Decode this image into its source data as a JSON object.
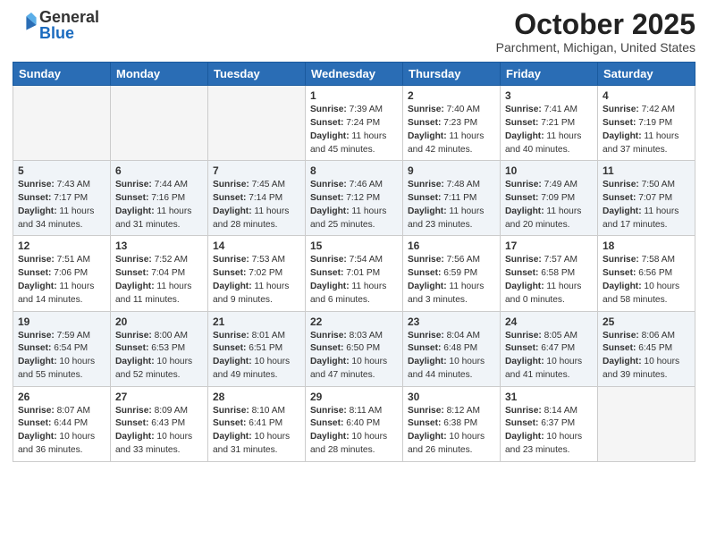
{
  "header": {
    "logo_general": "General",
    "logo_blue": "Blue",
    "month_title": "October 2025",
    "location": "Parchment, Michigan, United States"
  },
  "days_of_week": [
    "Sunday",
    "Monday",
    "Tuesday",
    "Wednesday",
    "Thursday",
    "Friday",
    "Saturday"
  ],
  "weeks": [
    [
      {
        "day": "",
        "info": ""
      },
      {
        "day": "",
        "info": ""
      },
      {
        "day": "",
        "info": ""
      },
      {
        "day": "1",
        "info": "Sunrise: 7:39 AM\nSunset: 7:24 PM\nDaylight: 11 hours\nand 45 minutes."
      },
      {
        "day": "2",
        "info": "Sunrise: 7:40 AM\nSunset: 7:23 PM\nDaylight: 11 hours\nand 42 minutes."
      },
      {
        "day": "3",
        "info": "Sunrise: 7:41 AM\nSunset: 7:21 PM\nDaylight: 11 hours\nand 40 minutes."
      },
      {
        "day": "4",
        "info": "Sunrise: 7:42 AM\nSunset: 7:19 PM\nDaylight: 11 hours\nand 37 minutes."
      }
    ],
    [
      {
        "day": "5",
        "info": "Sunrise: 7:43 AM\nSunset: 7:17 PM\nDaylight: 11 hours\nand 34 minutes."
      },
      {
        "day": "6",
        "info": "Sunrise: 7:44 AM\nSunset: 7:16 PM\nDaylight: 11 hours\nand 31 minutes."
      },
      {
        "day": "7",
        "info": "Sunrise: 7:45 AM\nSunset: 7:14 PM\nDaylight: 11 hours\nand 28 minutes."
      },
      {
        "day": "8",
        "info": "Sunrise: 7:46 AM\nSunset: 7:12 PM\nDaylight: 11 hours\nand 25 minutes."
      },
      {
        "day": "9",
        "info": "Sunrise: 7:48 AM\nSunset: 7:11 PM\nDaylight: 11 hours\nand 23 minutes."
      },
      {
        "day": "10",
        "info": "Sunrise: 7:49 AM\nSunset: 7:09 PM\nDaylight: 11 hours\nand 20 minutes."
      },
      {
        "day": "11",
        "info": "Sunrise: 7:50 AM\nSunset: 7:07 PM\nDaylight: 11 hours\nand 17 minutes."
      }
    ],
    [
      {
        "day": "12",
        "info": "Sunrise: 7:51 AM\nSunset: 7:06 PM\nDaylight: 11 hours\nand 14 minutes."
      },
      {
        "day": "13",
        "info": "Sunrise: 7:52 AM\nSunset: 7:04 PM\nDaylight: 11 hours\nand 11 minutes."
      },
      {
        "day": "14",
        "info": "Sunrise: 7:53 AM\nSunset: 7:02 PM\nDaylight: 11 hours\nand 9 minutes."
      },
      {
        "day": "15",
        "info": "Sunrise: 7:54 AM\nSunset: 7:01 PM\nDaylight: 11 hours\nand 6 minutes."
      },
      {
        "day": "16",
        "info": "Sunrise: 7:56 AM\nSunset: 6:59 PM\nDaylight: 11 hours\nand 3 minutes."
      },
      {
        "day": "17",
        "info": "Sunrise: 7:57 AM\nSunset: 6:58 PM\nDaylight: 11 hours\nand 0 minutes."
      },
      {
        "day": "18",
        "info": "Sunrise: 7:58 AM\nSunset: 6:56 PM\nDaylight: 10 hours\nand 58 minutes."
      }
    ],
    [
      {
        "day": "19",
        "info": "Sunrise: 7:59 AM\nSunset: 6:54 PM\nDaylight: 10 hours\nand 55 minutes."
      },
      {
        "day": "20",
        "info": "Sunrise: 8:00 AM\nSunset: 6:53 PM\nDaylight: 10 hours\nand 52 minutes."
      },
      {
        "day": "21",
        "info": "Sunrise: 8:01 AM\nSunset: 6:51 PM\nDaylight: 10 hours\nand 49 minutes."
      },
      {
        "day": "22",
        "info": "Sunrise: 8:03 AM\nSunset: 6:50 PM\nDaylight: 10 hours\nand 47 minutes."
      },
      {
        "day": "23",
        "info": "Sunrise: 8:04 AM\nSunset: 6:48 PM\nDaylight: 10 hours\nand 44 minutes."
      },
      {
        "day": "24",
        "info": "Sunrise: 8:05 AM\nSunset: 6:47 PM\nDaylight: 10 hours\nand 41 minutes."
      },
      {
        "day": "25",
        "info": "Sunrise: 8:06 AM\nSunset: 6:45 PM\nDaylight: 10 hours\nand 39 minutes."
      }
    ],
    [
      {
        "day": "26",
        "info": "Sunrise: 8:07 AM\nSunset: 6:44 PM\nDaylight: 10 hours\nand 36 minutes."
      },
      {
        "day": "27",
        "info": "Sunrise: 8:09 AM\nSunset: 6:43 PM\nDaylight: 10 hours\nand 33 minutes."
      },
      {
        "day": "28",
        "info": "Sunrise: 8:10 AM\nSunset: 6:41 PM\nDaylight: 10 hours\nand 31 minutes."
      },
      {
        "day": "29",
        "info": "Sunrise: 8:11 AM\nSunset: 6:40 PM\nDaylight: 10 hours\nand 28 minutes."
      },
      {
        "day": "30",
        "info": "Sunrise: 8:12 AM\nSunset: 6:38 PM\nDaylight: 10 hours\nand 26 minutes."
      },
      {
        "day": "31",
        "info": "Sunrise: 8:14 AM\nSunset: 6:37 PM\nDaylight: 10 hours\nand 23 minutes."
      },
      {
        "day": "",
        "info": ""
      }
    ]
  ]
}
